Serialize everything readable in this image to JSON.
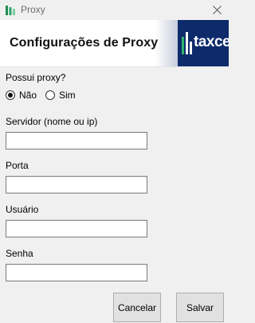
{
  "window": {
    "title": "Proxy",
    "icon": "app-icon",
    "close_icon": "close-icon"
  },
  "header": {
    "title": "Configurações de Proxy",
    "logo_text": "taxcel",
    "logo_color": "#0d2a6b"
  },
  "form": {
    "has_proxy_label": "Possui proxy?",
    "options": [
      {
        "label": "Não",
        "checked": true
      },
      {
        "label": "Sim",
        "checked": false
      }
    ],
    "fields": [
      {
        "label": "Servidor (nome ou ip)",
        "value": ""
      },
      {
        "label": "Porta",
        "value": ""
      },
      {
        "label": "Usuário",
        "value": ""
      },
      {
        "label": "Senha",
        "value": ""
      }
    ]
  },
  "buttons": {
    "cancel": "Cancelar",
    "save": "Salvar"
  }
}
